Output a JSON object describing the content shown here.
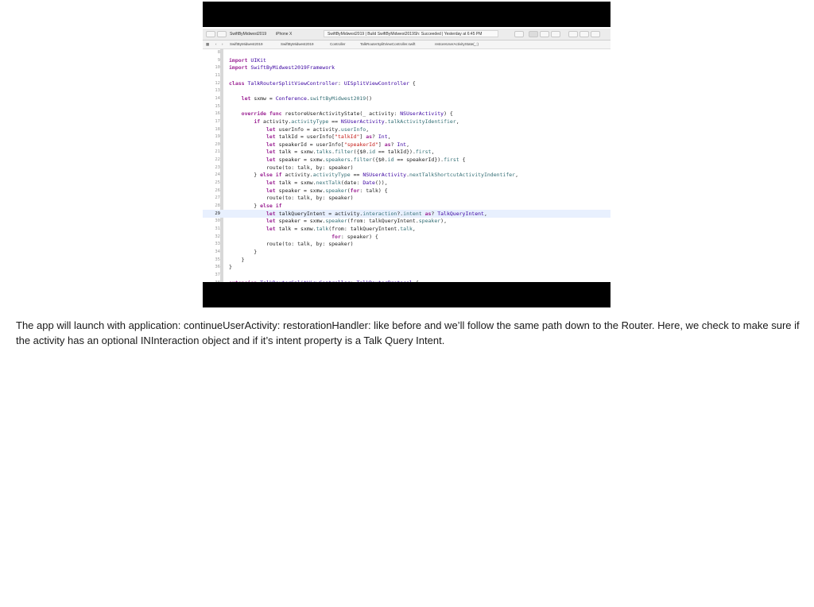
{
  "toolbar": {
    "scheme": "SwiftByMidwest2019",
    "device": "iPhone X",
    "status": "SwiftByMidwest2019 | Build SwiftByMidwest2019Sh: Succeeded | Yesterday at 6:45 PM"
  },
  "jumpbar": {
    "items": [
      "SwiftByMidwest2019",
      "SwiftByMidwest2019",
      "Controller",
      "TalkRouterSplitViewController.swift",
      "restoreUserActivityState(_:)"
    ]
  },
  "editor": {
    "highlighted_line": "29",
    "lines": [
      {
        "n": "8",
        "t": ""
      },
      {
        "n": "9",
        "t": "import UIKit"
      },
      {
        "n": "10",
        "t": "import SwiftByMidwest2019Framework"
      },
      {
        "n": "11",
        "t": ""
      },
      {
        "n": "12",
        "t": "class TalkRouterSplitViewController: UISplitViewController {"
      },
      {
        "n": "13",
        "t": ""
      },
      {
        "n": "14",
        "t": "    let sxmw = Conference.swiftByMidwest2019()"
      },
      {
        "n": "15",
        "t": ""
      },
      {
        "n": "16",
        "t": "    override func restoreUserActivityState(_ activity: NSUserActivity) {"
      },
      {
        "n": "17",
        "t": "        if activity.activityType == NSUserActivity.talkActivityIdentifier,"
      },
      {
        "n": "18",
        "t": "            let userInfo = activity.userInfo,"
      },
      {
        "n": "19",
        "t": "            let talkId = userInfo[\"talkId\"] as? Int,"
      },
      {
        "n": "20",
        "t": "            let speakerId = userInfo[\"speakerId\"] as? Int,"
      },
      {
        "n": "21",
        "t": "            let talk = sxmw.talks.filter({$0.id == talkId}).first,"
      },
      {
        "n": "22",
        "t": "            let speaker = sxmw.speakers.filter({$0.id == speakerId}).first {"
      },
      {
        "n": "23",
        "t": "            route(to: talk, by: speaker)"
      },
      {
        "n": "24",
        "t": "        } else if activity.activityType == NSUserActivity.nextTalkShortcutActivityIndentifer,"
      },
      {
        "n": "25",
        "t": "            let talk = sxmw.nextTalk(date: Date()),"
      },
      {
        "n": "26",
        "t": "            let speaker = sxmw.speaker(for: talk) {"
      },
      {
        "n": "27",
        "t": "            route(to: talk, by: speaker)"
      },
      {
        "n": "28",
        "t": "        } else if"
      },
      {
        "n": "29",
        "t": "            let talkQueryIntent = activity.interaction?.intent as? TalkQueryIntent,"
      },
      {
        "n": "30",
        "t": "            let speaker = sxmw.speaker(from: talkQueryIntent.speaker),"
      },
      {
        "n": "31",
        "t": "            let talk = sxmw.talk(from: talkQueryIntent.talk,"
      },
      {
        "n": "32",
        "t": "                                 for: speaker) {"
      },
      {
        "n": "33",
        "t": "            route(to: talk, by: speaker)"
      },
      {
        "n": "34",
        "t": "        }"
      },
      {
        "n": "35",
        "t": "    }"
      },
      {
        "n": "36",
        "t": "}"
      },
      {
        "n": "37",
        "t": ""
      },
      {
        "n": "38",
        "t": "extension TalkRouterSplitViewController: TalkRouterProtocol {"
      }
    ]
  },
  "caption": "The app will launch with application: continueUserActivity: restorationHandler: like before and we’ll follow the same path down to the Router. Here, we check to make sure if the activity has an optional INInteraction object and if it’s intent property is a Talk Query Intent.",
  "colors": {
    "keyword": "#9b2393",
    "type": "#3900a0",
    "property": "#326d74",
    "string": "#c41a16",
    "highlight": "#e8f0fe"
  }
}
